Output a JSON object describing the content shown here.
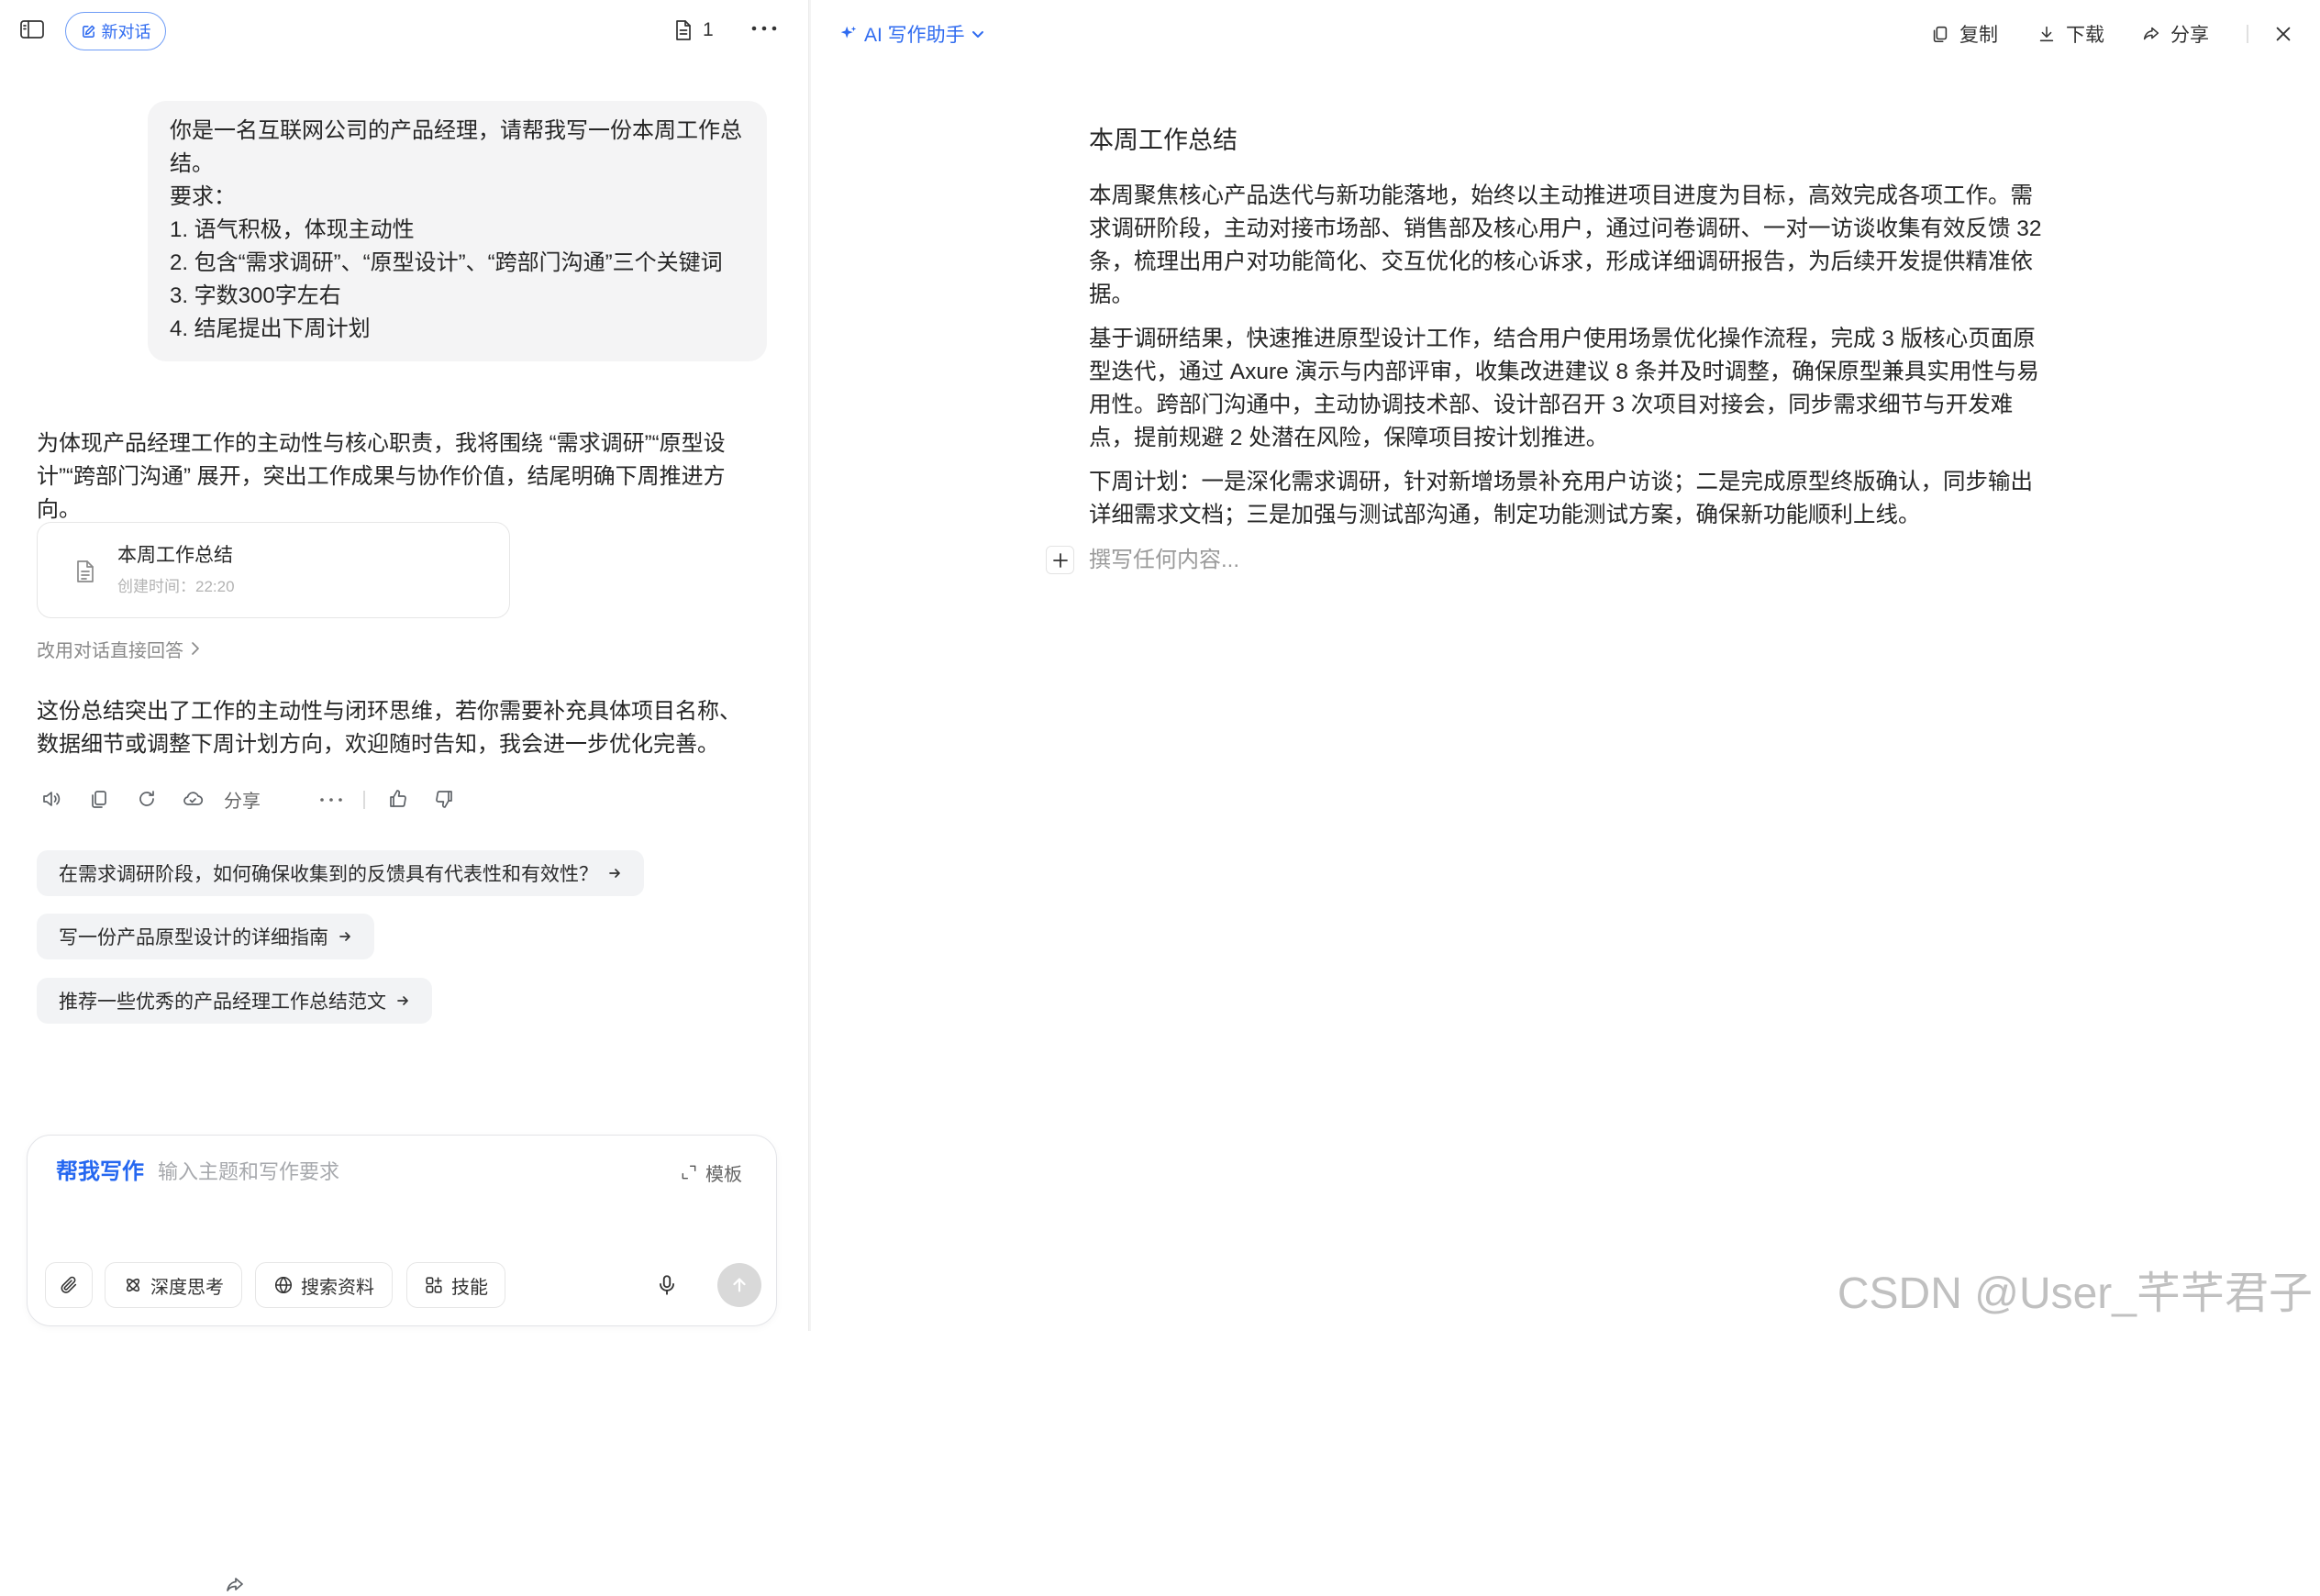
{
  "left": {
    "topbar": {
      "new_chat": "新对话",
      "doc_count": "1"
    },
    "user_message": {
      "lines": [
        "你是一名互联网公司的产品经理，请帮我写一份本周工作总结。",
        "要求：",
        "1. 语气积极，体现主动性",
        "2. 包含“需求调研”、“原型设计”、“跨部门沟通”三个关键词",
        "3. 字数300字左右",
        "4. 结尾提出下周计划"
      ]
    },
    "ai_intro": "为体现产品经理工作的主动性与核心职责，我将围绕 “需求调研”“原型设计”“跨部门沟通” 展开，突出工作成果与协作价值，结尾明确下周推进方向。",
    "doc_card": {
      "title": "本周工作总结",
      "created": "创建时间：22:20"
    },
    "switch_link": "改用对话直接回答",
    "ai_followup": "这份总结突出了工作的主动性与闭环思维，若你需要补充具体项目名称、数据细节或调整下周计划方向，欢迎随时告知，我会进一步优化完善。",
    "actions": {
      "share": "分享"
    },
    "suggestions": [
      {
        "text": "在需求调研阶段，如何确保收集到的反馈具有代表性和有效性？"
      },
      {
        "text": "写一份产品原型设计的详细指南"
      },
      {
        "text": "推荐一些优秀的产品经理工作总结范文"
      }
    ],
    "composer": {
      "mode": "帮我写作",
      "placeholder": "输入主题和写作要求",
      "template": "模板",
      "tools": [
        "深度思考",
        "搜索资料",
        "技能"
      ]
    }
  },
  "right": {
    "assistant": "AI 写作助手",
    "actions": {
      "copy": "复制",
      "download": "下载",
      "share": "分享"
    },
    "doc": {
      "title": "本周工作总结",
      "paragraphs": [
        "本周聚焦核心产品迭代与新功能落地，始终以主动推进项目进度为目标，高效完成各项工作。需求调研阶段，主动对接市场部、销售部及核心用户，通过问卷调研、一对一访谈收集有效反馈 32 条，梳理出用户对功能简化、交互优化的核心诉求，形成详细调研报告，为后续开发提供精准依据。",
        "基于调研结果，快速推进原型设计工作，结合用户使用场景优化操作流程，完成 3 版核心页面原型迭代，通过 Axure 演示与内部评审，收集改进建议 8 条并及时调整，确保原型兼具实用性与易用性。跨部门沟通中，主动协调技术部、设计部召开 3 次项目对接会，同步需求细节与开发难点，提前规避 2 处潜在风险，保障项目按计划推进。",
        "下周计划：一是深化需求调研，针对新增场景补充用户访谈；二是完成原型终版确认，同步输出详细需求文档；三是加强与测试部沟通，制定功能测试方案，确保新功能顺利上线。"
      ],
      "placeholder": "撰写任何内容..."
    }
  },
  "watermark": "CSDN @User_芊芊君子",
  "colors": {
    "accent": "#2f6bf0",
    "bubble": "#f4f4f5",
    "chip": "#f2f3f5",
    "send_disabled": "#d9d9d9"
  },
  "icons": [
    "sidebar-toggle-icon",
    "edit-icon",
    "document-icon",
    "more-icon",
    "file-icon",
    "chevron-right-icon",
    "speaker-icon",
    "copy-icon",
    "refresh-icon",
    "cloud-save-icon",
    "share-icon",
    "thumbs-up-icon",
    "thumbs-down-icon",
    "arrow-right-icon",
    "expand-icon",
    "paperclip-icon",
    "atom-icon",
    "globe-icon",
    "skills-icon",
    "mic-icon",
    "arrow-up-icon",
    "sparkle-icon",
    "chevron-down-icon",
    "download-icon",
    "close-icon",
    "plus-icon"
  ]
}
